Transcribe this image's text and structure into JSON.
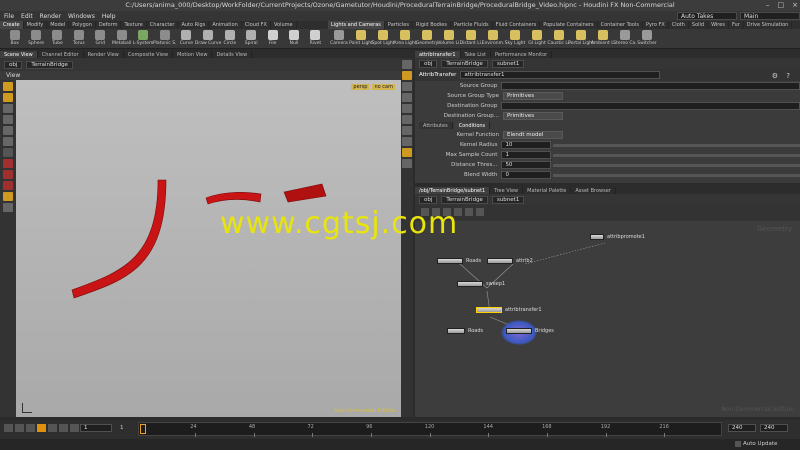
{
  "window": {
    "title": "C:/Users/anima_000/Desktop/WorkFolder/CurrentProjects/Ozone/Gametutor/Houdini/ProceduralTerrainBridge/ProceduralBridge_Video.hipnc - Houdini FX Non-Commercial",
    "controls": [
      "–",
      "□",
      "×"
    ]
  },
  "menubar": {
    "items": [
      "File",
      "Edit",
      "Render",
      "Windows",
      "Help"
    ],
    "desktop_label": "Auto Takes",
    "desktop_value": "Main"
  },
  "shelf_tabs_left": [
    "Create",
    "Modify",
    "Model",
    "Polygon",
    "Deform",
    "Texture",
    "Character",
    "Auto Rigs",
    "Animation",
    "Cloud FX",
    "Volume"
  ],
  "shelf_tabs_right": [
    "Lights and Cameras",
    "Particles",
    "Rigid Bodies",
    "Particle Fluids",
    "Fluid Containers",
    "Populate Containers",
    "Container Tools",
    "Pyro FX",
    "Cloth",
    "Solid",
    "Wires",
    "Fur",
    "Drive Simulation"
  ],
  "tools_left": [
    {
      "label": "Box",
      "color": "#8c8c8c"
    },
    {
      "label": "Sphere",
      "color": "#8c8c8c"
    },
    {
      "label": "Tube",
      "color": "#8c8c8c"
    },
    {
      "label": "Torus",
      "color": "#8c8c8c"
    },
    {
      "label": "Grid",
      "color": "#8c8c8c"
    },
    {
      "label": "Metaball",
      "color": "#8c8c8c"
    },
    {
      "label": "L-System",
      "color": "#7aa860"
    },
    {
      "label": "Platonic S.",
      "color": "#8c8c8c"
    },
    {
      "label": "Curve",
      "color": "#b0b0b0"
    },
    {
      "label": "Draw Curve",
      "color": "#b0b0b0"
    },
    {
      "label": "Circle",
      "color": "#b0b0b0"
    },
    {
      "label": "Spiral",
      "color": "#b0b0b0"
    },
    {
      "label": "File",
      "color": "#d0d0d0"
    },
    {
      "label": "Null",
      "color": "#d0d0d0"
    },
    {
      "label": "Rivet",
      "color": "#d0d0d0"
    }
  ],
  "tools_right": [
    {
      "label": "Camera",
      "color": "#9a9a9a"
    },
    {
      "label": "Point Light",
      "color": "#d8c060"
    },
    {
      "label": "Spot Light",
      "color": "#d8c060"
    },
    {
      "label": "Area Light",
      "color": "#d8c060"
    },
    {
      "label": "Geometry",
      "color": "#d8c060"
    },
    {
      "label": "Volume Li.",
      "color": "#d8c060"
    },
    {
      "label": "Distant Li.",
      "color": "#d8c060"
    },
    {
      "label": "Environm.",
      "color": "#d8c060"
    },
    {
      "label": "Sky Light",
      "color": "#d8c060"
    },
    {
      "label": "GI Light",
      "color": "#d8c060"
    },
    {
      "label": "Caustic Li.",
      "color": "#d8c060"
    },
    {
      "label": "Portal Light",
      "color": "#d8c060"
    },
    {
      "label": "Ambient L.",
      "color": "#d8c060"
    },
    {
      "label": "Stereo Ca.",
      "color": "#9a9a9a"
    },
    {
      "label": "Switcher",
      "color": "#9a9a9a"
    }
  ],
  "left_pane": {
    "tabs": [
      "Scene View",
      "Channel Editor",
      "Render View",
      "Composite View",
      "Motion View",
      "Details View"
    ],
    "path": [
      "obj",
      "TerrainBridge"
    ],
    "view_label": "View",
    "camera_chips": [
      "persp",
      "no cam"
    ],
    "footer_text": "Non-Commercial Edition"
  },
  "param_pane": {
    "tabs": [
      "attribtransfer1",
      "Take List",
      "Performance Monitor"
    ],
    "path": [
      "obj",
      "TerrainBridge",
      "subnet1"
    ],
    "node_type": "AttribTransfer",
    "node_name": "attribtransfer1",
    "rows": [
      {
        "label": "Source Group",
        "value": "",
        "kind": "field"
      },
      {
        "label": "Source Group Type",
        "value": "Primitives",
        "kind": "drop"
      },
      {
        "label": "Destination Group",
        "value": "",
        "kind": "field"
      },
      {
        "label": "Destination Group...",
        "value": "Primitives",
        "kind": "drop"
      }
    ],
    "subtabs": [
      "Attributes",
      "Conditions"
    ],
    "cond_rows": [
      {
        "label": "Kernel Function",
        "value": "Elendt model",
        "kind": "drop"
      },
      {
        "label": "Kernel Radius",
        "value": "10",
        "kind": "num"
      },
      {
        "label": "Max Sample Count",
        "value": "1",
        "kind": "num"
      },
      {
        "label": "Distance Thres...",
        "value": "50",
        "kind": "num"
      },
      {
        "label": "Blend Width",
        "value": "0",
        "kind": "num"
      }
    ]
  },
  "network_pane": {
    "tabs": [
      "/obj/TerrainBridge/subnet1",
      "Tree View",
      "Material Palette",
      "Asset Browser"
    ],
    "path": [
      "obj",
      "TerrainBridge",
      "subnet1"
    ],
    "watermark_right": "Geometry",
    "footer_text": "Non-Commercial Edition",
    "nodes": [
      {
        "label": "attribpromote1"
      },
      {
        "label": "Roads"
      },
      {
        "label": "attrib2"
      },
      {
        "label": "sweep1"
      },
      {
        "label": "attribtransfer1"
      },
      {
        "label": "Roads"
      },
      {
        "label": "Bridges"
      }
    ]
  },
  "timeline": {
    "frame": "1",
    "start": "1",
    "ticks": [
      "24",
      "48",
      "72",
      "96",
      "120",
      "144",
      "168",
      "192",
      "216"
    ],
    "end": "240",
    "end2": "240"
  },
  "status": {
    "auto_update": "Auto Update"
  },
  "overlay_watermark": "www.cgtsj.com",
  "colors": {
    "bridge": "#c81414",
    "watermark": "#e8e40c",
    "current_frame": "#f0a020"
  }
}
